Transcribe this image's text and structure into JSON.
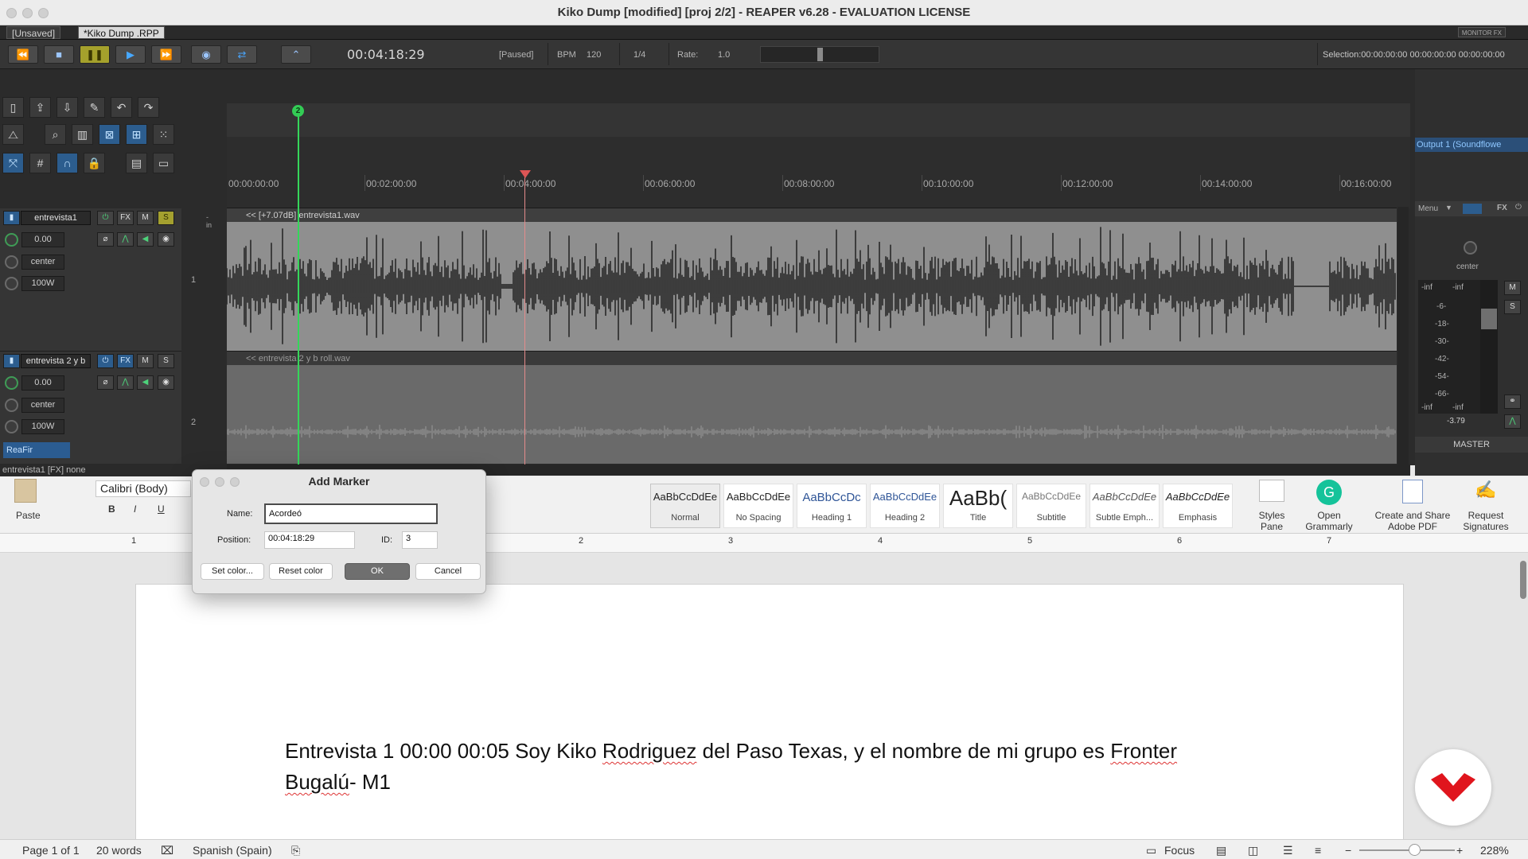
{
  "window": {
    "title": "Kiko Dump  [modified] [proj 2/2] - REAPER v6.28 - EVALUATION LICENSE"
  },
  "tabs": [
    {
      "label": "[Unsaved]"
    },
    {
      "label": "*Kiko Dump .RPP"
    }
  ],
  "monitor_fx": "MONITOR FX",
  "transport": {
    "timecode": "00:04:18:29",
    "state": "[Paused]",
    "bpm_label": "BPM",
    "bpm": "120",
    "grid": "1/4",
    "rate_label": "Rate:",
    "rate": "1.0",
    "rate_level": 0.5,
    "selection": "Selection:00:00:00:00 00:00:00:00 00:00:00:00"
  },
  "timeline": {
    "marker": "2",
    "ticks": [
      "00:00:00:00",
      "00:02:00:00",
      "00:04:00:00",
      "00:06:00:00",
      "00:08:00:00",
      "00:10:00:00",
      "00:12:00:00",
      "00:14:00:00",
      "00:16:00:00"
    ]
  },
  "tracks": [
    {
      "name": "entrevista1",
      "volume": "0.00",
      "pan": "center",
      "width": "100W",
      "number": "1",
      "item": "<< [+7.07dB] entrevista1.wav",
      "in_label": "-in"
    },
    {
      "name": "entrevista 2 y b",
      "volume": "0.00",
      "pan": "center",
      "width": "100W",
      "number": "2",
      "item": "<< entrevista 2 y b roll.wav",
      "fx": "ReaFir"
    }
  ],
  "track_buttons": {
    "fx": "FX",
    "mute": "M",
    "solo": "S"
  },
  "mixer": {
    "output": "Output 1 (Soundflowe",
    "menu": "Menu",
    "fx": "FX",
    "pan": "center",
    "peak_l": "-inf",
    "peak_r": "-inf",
    "scale": [
      "-6-",
      "-18-",
      "-30-",
      "-42-",
      "-54-",
      "-66-"
    ],
    "bottom_l": "-inf",
    "bottom_r": "-inf",
    "gain": "-3.79",
    "mute": "M",
    "solo": "S",
    "label": "MASTER"
  },
  "reaper_status": "entrevista1 [FX] none",
  "word": {
    "paste": "Paste",
    "font": "Calibri (Body)",
    "bold": "B",
    "italic": "I",
    "underline": "U",
    "styles": [
      {
        "sample": "AaBbCcDdEe",
        "name": "Normal"
      },
      {
        "sample": "AaBbCcDdEe",
        "name": "No Spacing"
      },
      {
        "sample": "AaBbCcDc",
        "name": "Heading 1"
      },
      {
        "sample": "AaBbCcDdEe",
        "name": "Heading 2"
      },
      {
        "sample": "AaBb(",
        "name": "Title"
      },
      {
        "sample": "AaBbCcDdEe",
        "name": "Subtitle"
      },
      {
        "sample": "AaBbCcDdEe",
        "name": "Subtle Emph..."
      },
      {
        "sample": "AaBbCcDdEe",
        "name": "Emphasis"
      }
    ],
    "styles_pane": "Styles Pane",
    "grammarly": "Open Grammarly",
    "adobe": "Create and Share Adobe PDF",
    "signatures": "Request Signatures",
    "ruler_nums": [
      "1",
      "2",
      "3",
      "4",
      "5",
      "6",
      "7"
    ],
    "doc": {
      "p1": "Entrevista 1 00:00 00:05 Soy Kiko ",
      "w1": "Rodriguez",
      "p2": " del Paso Texas, y el nombre de mi grupo es ",
      "w2": "Fronter",
      "w3": "Bugalú",
      "p3": "- M1"
    },
    "status": {
      "page": "Page 1 of 1",
      "words": "20 words",
      "language": "Spanish (Spain)",
      "focus": "Focus",
      "zoom": "228%"
    }
  },
  "dialog": {
    "title": "Add Marker",
    "name_label": "Name:",
    "name_value": "Acordeó",
    "position_label": "Position:",
    "position_value": "00:04:18:29",
    "id_label": "ID:",
    "id_value": "3",
    "set_color": "Set color...",
    "reset_color": "Reset color",
    "ok": "OK",
    "cancel": "Cancel"
  },
  "colors": {
    "marker": "#33cc55",
    "playhead": "#e48b8b",
    "accent": "#2c5d8e"
  }
}
